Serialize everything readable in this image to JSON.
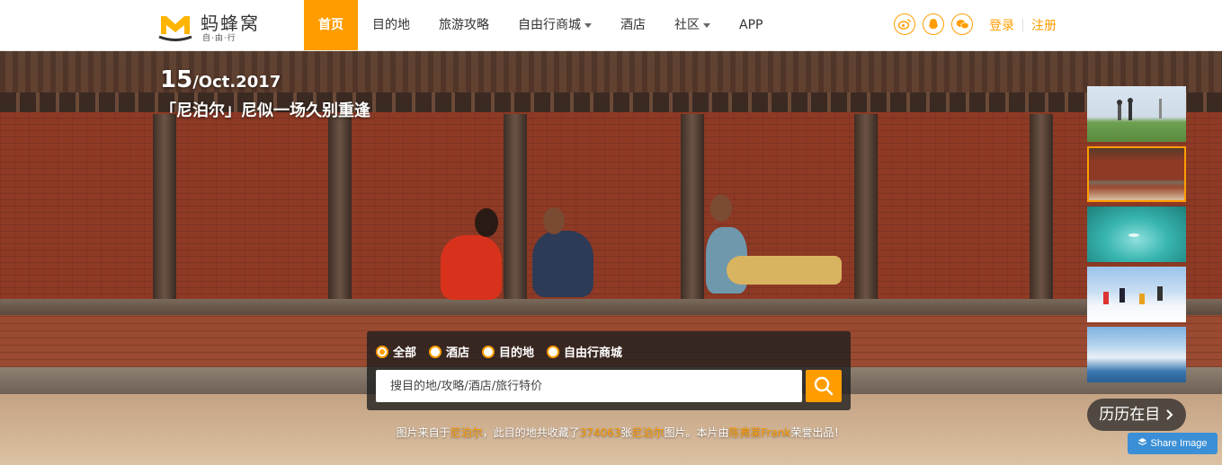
{
  "header": {
    "logo": {
      "name": "蚂蜂窝",
      "tagline": "自·由·行"
    },
    "nav": [
      {
        "label": "首页",
        "active": true,
        "dropdown": false
      },
      {
        "label": "目的地",
        "active": false,
        "dropdown": false
      },
      {
        "label": "旅游攻略",
        "active": false,
        "dropdown": false
      },
      {
        "label": "自由行商城",
        "active": false,
        "dropdown": true
      },
      {
        "label": "酒店",
        "active": false,
        "dropdown": false
      },
      {
        "label": "社区",
        "active": false,
        "dropdown": true
      },
      {
        "label": "APP",
        "active": false,
        "dropdown": false
      }
    ],
    "social_icons": [
      "weibo-icon",
      "qq-icon",
      "wechat-icon"
    ],
    "login_label": "登录",
    "register_label": "注册",
    "accent_color": "#ff9d00"
  },
  "hero": {
    "day": "15",
    "month_year": "/Oct.2017",
    "title": "「尼泊尔」尼似一场久别重逢",
    "more_label": "历历在目",
    "thumbnails": [
      {
        "active": false
      },
      {
        "active": true
      },
      {
        "active": false
      },
      {
        "active": false
      },
      {
        "active": false
      }
    ]
  },
  "search": {
    "options": [
      {
        "label": "全部",
        "checked": true
      },
      {
        "label": "酒店",
        "checked": false
      },
      {
        "label": "目的地",
        "checked": false
      },
      {
        "label": "自由行商城",
        "checked": false
      }
    ],
    "placeholder": "搜目的地/攻略/酒店/旅行特价"
  },
  "credit": {
    "p1": "图片来自于",
    "place": "尼泊尔",
    "p2": "，此目的地共收藏了",
    "count": "374063",
    "p3": "张",
    "place2": "尼泊尔",
    "p4": "图片。本片由",
    "author": "陈弗莱Frank",
    "p5": "荣誉出品！"
  },
  "share_label": "Share Image"
}
